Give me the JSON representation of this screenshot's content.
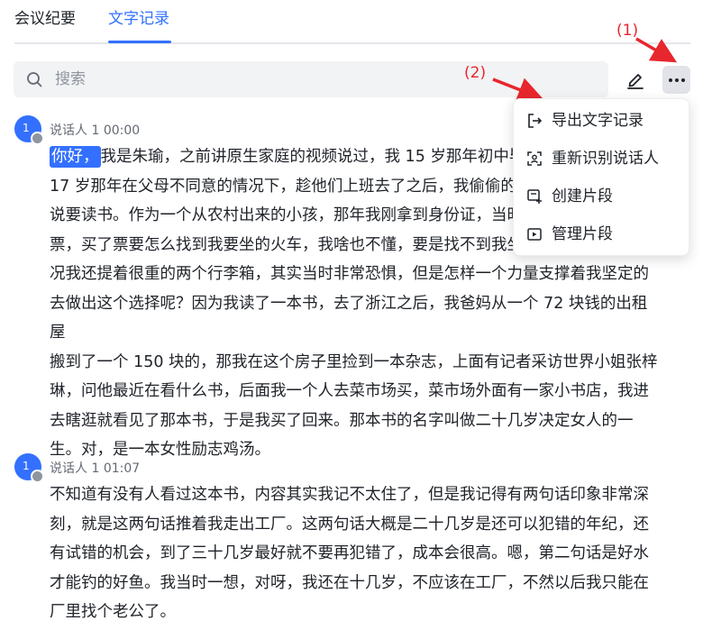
{
  "tabs": [
    {
      "label": "会议纪要"
    },
    {
      "label": "文字记录"
    }
  ],
  "search": {
    "placeholder": "搜索"
  },
  "annotations": {
    "one": "(1)",
    "two": "(2)"
  },
  "menu": {
    "items": [
      {
        "label": "导出文字记录",
        "icon": "export-icon"
      },
      {
        "label": "重新识别说话人",
        "icon": "speaker-scan-icon"
      },
      {
        "label": "创建片段",
        "icon": "create-clip-icon"
      },
      {
        "label": "管理片段",
        "icon": "manage-clips-icon"
      }
    ]
  },
  "colors": {
    "accent": "#3370ff",
    "annotation": "#e8262d"
  },
  "transcript": [
    {
      "avatar": "1",
      "speaker": "说话人 1",
      "time": "00:00",
      "highlight": "你好，",
      "lines": [
        "我是朱瑜，之前讲原生家庭的视频说过，我 15 岁那年初中毕",
        "17 岁那年在父母不同意的情况下，趁他们上班去了之后，我偷偷的",
        "说要读书。作为一个从农村出来的小孩，那年我刚拿到身份证，当时",
        "票，买了票要怎么找到我要坐的火车，我啥也不懂，要是找不到我坐",
        "况我还提着很重的两个行李箱，其实当时非常恐惧，但是怎样一个力量支撑着我坚定的",
        "去做出这个选择呢？因为我读了一本书，去了浙江之后，我爸妈从一个 72 块钱的出租屋",
        "搬到了一个 150 块的，那我在这个房子里捡到一本杂志，上面有记者采访世界小姐张梓",
        "琳，问他最近在看什么书，后面我一个人去菜市场买，菜市场外面有一家小书店，我进",
        "去瞎逛就看见了那本书，于是我买了回来。那本书的名字叫做二十几岁决定女人的一",
        "生。对，是一本女性励志鸡汤。"
      ]
    },
    {
      "avatar": "1",
      "speaker": "说话人 1",
      "time": "01:07",
      "lines": [
        "不知道有没有人看过这本书，内容其实我记不太住了，但是我记得有两句话印象非常深",
        "刻，就是这两句话推着我走出工厂。这两句话大概是二十几岁是还可以犯错的年纪，还",
        "有试错的机会，到了三十几岁最好就不要再犯错了，成本会很高。嗯，第二句话是好水",
        "才能钓的好鱼。我当时一想，对呀，我还在十几岁，不应该在工厂，不然以后我只能在",
        "厂里找个老公了。"
      ]
    }
  ]
}
